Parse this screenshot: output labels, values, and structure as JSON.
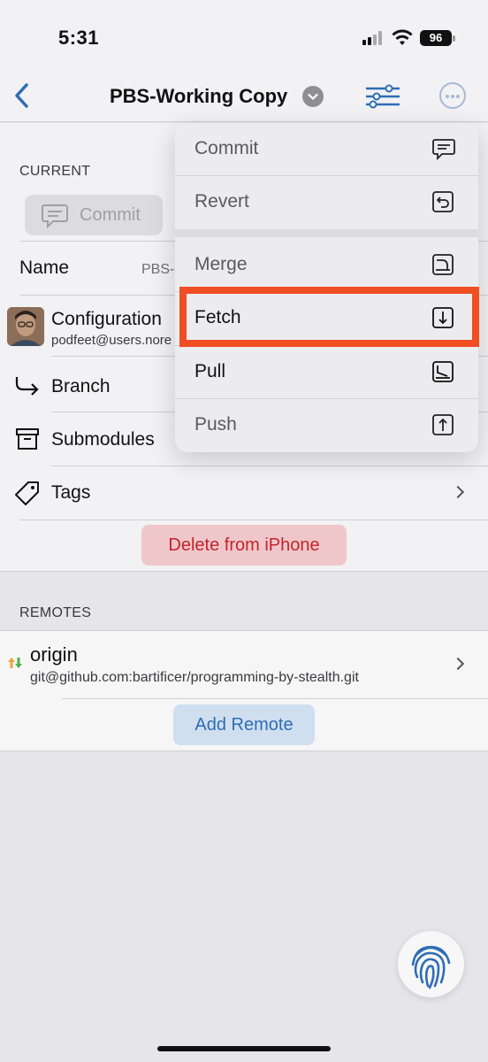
{
  "status": {
    "time": "5:31",
    "battery": "96"
  },
  "nav": {
    "title": "PBS-Working Copy"
  },
  "current": {
    "header": "CURRENT",
    "commit_label": "Commit",
    "name_label": "Name",
    "name_value": "PBS-",
    "configuration_label": "Configuration",
    "configuration_email": "podfeet@users.nore",
    "branch_label": "Branch",
    "submodules_label": "Submodules",
    "tags_label": "Tags",
    "delete_label": "Delete from iPhone"
  },
  "remotes": {
    "header": "REMOTES",
    "origin_name": "origin",
    "origin_url": "git@github.com:bartificer/programming-by-stealth.git",
    "add_label": "Add Remote"
  },
  "menu": {
    "items": [
      {
        "label": "Commit",
        "icon": "commit-bubble-icon"
      },
      {
        "label": "Revert",
        "icon": "revert-icon"
      },
      {
        "label": "Merge",
        "icon": "merge-icon"
      },
      {
        "label": "Fetch",
        "icon": "fetch-icon",
        "highlighted": true
      },
      {
        "label": "Pull",
        "icon": "pull-icon"
      },
      {
        "label": "Push",
        "icon": "push-icon"
      }
    ]
  },
  "colors": {
    "accent": "#2e6db5",
    "destructive": "#c4242c",
    "highlight": "#f04e23"
  }
}
